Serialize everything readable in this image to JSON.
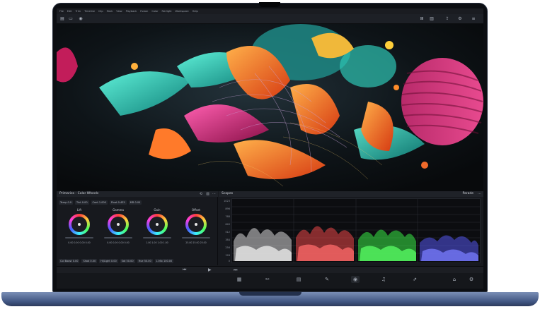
{
  "menu": {
    "items": [
      "File",
      "Edit",
      "Trim",
      "Timeline",
      "Clip",
      "Mark",
      "View",
      "Playback",
      "Fusion",
      "Color",
      "Fairlight",
      "Workspace",
      "Help"
    ]
  },
  "toolbar": {
    "parade_label": "Parade"
  },
  "wheels_panel": {
    "title": "Primaries - Color Wheels",
    "controls": [
      {
        "label": "Temp",
        "value": "0.0"
      },
      {
        "label": "Tint",
        "value": "0.00"
      },
      {
        "label": "Cont",
        "value": "1.000"
      },
      {
        "label": "Pivot",
        "value": "0.435"
      },
      {
        "label": "MD",
        "value": "0.00"
      }
    ],
    "wheels": [
      {
        "name": "Lift",
        "values": "0.00  0.00  0.00  0.00"
      },
      {
        "name": "Gamma",
        "values": "0.00  0.00  0.00  0.00"
      },
      {
        "name": "Gain",
        "values": "1.00  1.00  1.00  1.00"
      },
      {
        "name": "Offset",
        "values": "25.00  25.00  25.00"
      }
    ],
    "adjustments": [
      {
        "label": "Col Boost",
        "value": "0.00"
      },
      {
        "label": "Shad",
        "value": "0.00"
      },
      {
        "label": "Hi/Light",
        "value": "0.00"
      },
      {
        "label": "Sat",
        "value": "50.00"
      },
      {
        "label": "Hue",
        "value": "50.00"
      },
      {
        "label": "L.Mix",
        "value": "100.00"
      }
    ]
  },
  "scopes_panel": {
    "title": "Scopes",
    "mode": "Parade",
    "scale": [
      "1023",
      "896",
      "768",
      "640",
      "512",
      "384",
      "256",
      "128",
      "0"
    ],
    "channels": [
      {
        "name": "Luma",
        "color": "#d8d8d8"
      },
      {
        "name": "Red",
        "color": "#ff4b4b"
      },
      {
        "name": "Green",
        "color": "#3cff4a"
      },
      {
        "name": "Blue",
        "color": "#5a5cff"
      }
    ]
  },
  "pages": [
    {
      "icon": "media-page-icon"
    },
    {
      "icon": "cut-page-icon"
    },
    {
      "icon": "edit-page-icon"
    },
    {
      "icon": "fusion-page-icon"
    },
    {
      "icon": "color-page-icon"
    },
    {
      "icon": "fairlight-page-icon"
    },
    {
      "icon": "deliver-page-icon"
    }
  ],
  "colors": {
    "laptop_base": "#3f5480",
    "app_background": "#17191e"
  }
}
